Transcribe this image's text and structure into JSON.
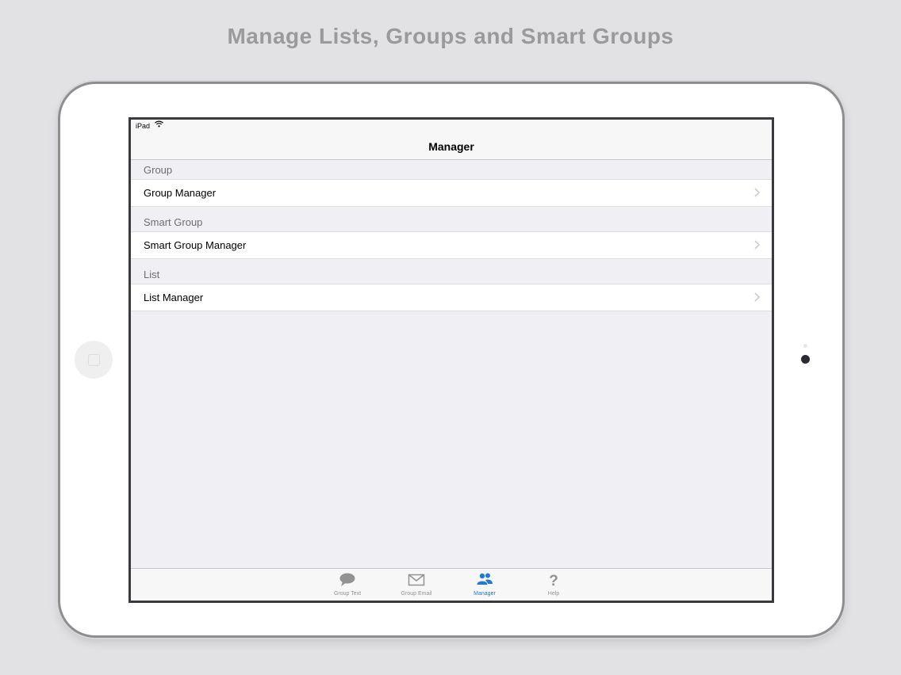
{
  "headline": "Manage Lists, Groups and Smart Groups",
  "status_bar": {
    "device": "iPad"
  },
  "nav": {
    "title": "Manager"
  },
  "sections": [
    {
      "header": "Group",
      "item": "Group Manager"
    },
    {
      "header": "Smart Group",
      "item": "Smart Group Manager"
    },
    {
      "header": "List",
      "item": "List Manager"
    }
  ],
  "tabs": [
    {
      "label": "Group Text",
      "icon": "speech-bubble-icon"
    },
    {
      "label": "Group Email",
      "icon": "envelope-icon"
    },
    {
      "label": "Manager",
      "icon": "people-icon",
      "selected": true
    },
    {
      "label": "Help",
      "icon": "question-mark-icon"
    }
  ],
  "colors": {
    "accent": "#1f7ad6",
    "inactive_tab": "#929292",
    "background": "#efeff4"
  }
}
